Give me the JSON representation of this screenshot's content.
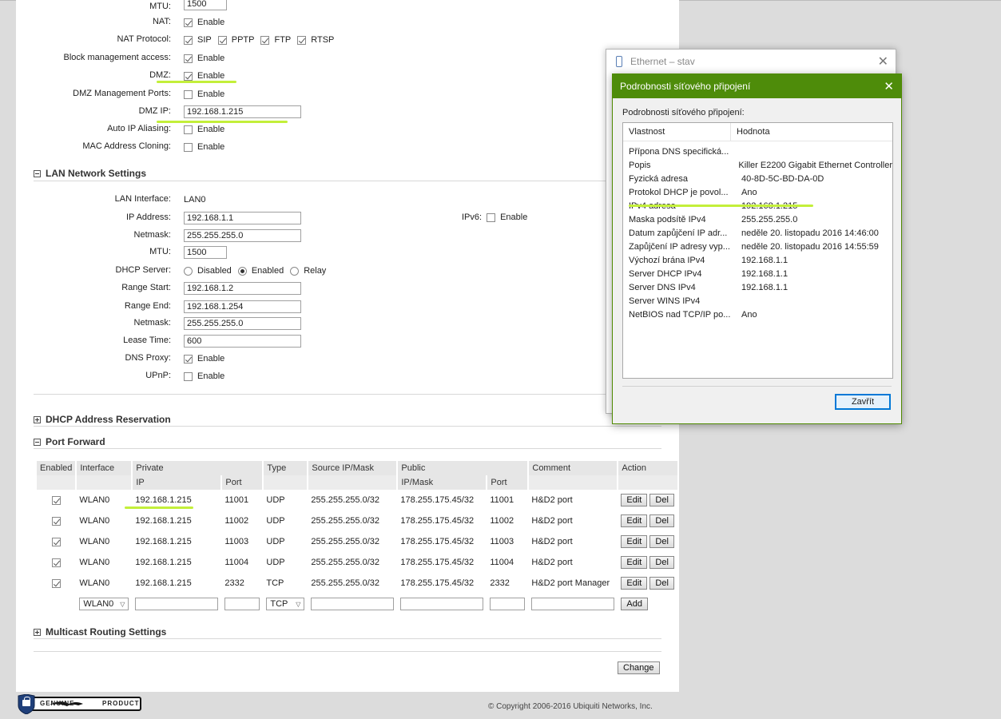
{
  "wan": {
    "mtu_label": "MTU:",
    "mtu_value": "1500",
    "nat_label": "NAT:",
    "nat_enable": "Enable",
    "nat_protocol_label": "NAT Protocol:",
    "nat_protocols": [
      "SIP",
      "PPTP",
      "FTP",
      "RTSP"
    ],
    "block_mgmt_label": "Block management access:",
    "block_mgmt_enable": "Enable",
    "dmz_label": "DMZ:",
    "dmz_enable": "Enable",
    "dmz_ports_label": "DMZ Management Ports:",
    "dmz_ports_enable": "Enable",
    "dmz_ip_label": "DMZ IP:",
    "dmz_ip_value": "192.168.1.215",
    "auto_ip_label": "Auto IP Aliasing:",
    "auto_ip_enable": "Enable",
    "mac_clone_label": "MAC Address Cloning:",
    "mac_clone_enable": "Enable"
  },
  "lan": {
    "section_title": "LAN Network Settings",
    "interface_label": "LAN Interface:",
    "interface_value": "LAN0",
    "ip_label": "IP Address:",
    "ip_value": "192.168.1.1",
    "netmask_label": "Netmask:",
    "netmask_value": "255.255.255.0",
    "mtu_label": "MTU:",
    "mtu_value": "1500",
    "ipv6_label": "IPv6:",
    "ipv6_enable": "Enable",
    "dhcp_label": "DHCP Server:",
    "dhcp_disabled": "Disabled",
    "dhcp_enabled": "Enabled",
    "dhcp_relay": "Relay",
    "range_start_label": "Range Start:",
    "range_start_value": "192.168.1.2",
    "range_end_label": "Range End:",
    "range_end_value": "192.168.1.254",
    "netmask2_label": "Netmask:",
    "netmask2_value": "255.255.255.0",
    "lease_label": "Lease Time:",
    "lease_value": "600",
    "dns_proxy_label": "DNS Proxy:",
    "dns_proxy_enable": "Enable",
    "upnp_label": "UPnP:",
    "upnp_enable": "Enable"
  },
  "dhcp_reservation": {
    "section_title": "DHCP Address Reservation"
  },
  "port_forward": {
    "section_title": "Port Forward",
    "headers": {
      "enabled": "Enabled",
      "interface": "Interface",
      "private": "Private",
      "type": "Type",
      "source": "Source IP/Mask",
      "public": "Public",
      "comment": "Comment",
      "action": "Action",
      "ip": "IP",
      "port": "Port",
      "ipmask": "IP/Mask",
      "port2": "Port"
    },
    "rows": [
      {
        "interface": "WLAN0",
        "ip": "192.168.1.215",
        "port": "11001",
        "type": "UDP",
        "source": "255.255.255.0/32",
        "public": "178.255.175.45/32",
        "pport": "11001",
        "comment": "H&D2 port"
      },
      {
        "interface": "WLAN0",
        "ip": "192.168.1.215",
        "port": "11002",
        "type": "UDP",
        "source": "255.255.255.0/32",
        "public": "178.255.175.45/32",
        "pport": "11002",
        "comment": "H&D2 port"
      },
      {
        "interface": "WLAN0",
        "ip": "192.168.1.215",
        "port": "11003",
        "type": "UDP",
        "source": "255.255.255.0/32",
        "public": "178.255.175.45/32",
        "pport": "11003",
        "comment": "H&D2 port"
      },
      {
        "interface": "WLAN0",
        "ip": "192.168.1.215",
        "port": "11004",
        "type": "UDP",
        "source": "255.255.255.0/32",
        "public": "178.255.175.45/32",
        "pport": "11004",
        "comment": "H&D2 port"
      },
      {
        "interface": "WLAN0",
        "ip": "192.168.1.215",
        "port": "2332",
        "type": "TCP",
        "source": "255.255.255.0/32",
        "public": "178.255.175.45/32",
        "pport": "2332",
        "comment": "H&D2 port Manager"
      }
    ],
    "edit_label": "Edit",
    "del_label": "Del",
    "new_interface": "WLAN0",
    "new_type": "TCP",
    "add_label": "Add"
  },
  "multicast": {
    "section_title": "Multicast Routing Settings"
  },
  "change_label": "Change",
  "footer": {
    "copyright": "© Copyright 2006-2016 Ubiquiti Networks, Inc.",
    "badge_left": "GENUINE",
    "badge_right": "PRODUCT"
  },
  "ethernet_window": {
    "title": "Ethernet – stav"
  },
  "details_window": {
    "title": "Podrobnosti síťového připojení",
    "caption": "Podrobnosti síťového připojení:",
    "col_property": "Vlastnost",
    "col_value": "Hodnota",
    "rows": [
      {
        "k": "Přípona DNS specifická...",
        "v": ""
      },
      {
        "k": "Popis",
        "v": "Killer E2200 Gigabit Ethernet Controller"
      },
      {
        "k": "Fyzická adresa",
        "v": "40-8D-5C-BD-DA-0D"
      },
      {
        "k": "Protokol DHCP je povol...",
        "v": "Ano"
      },
      {
        "k": "IPv4 adresa",
        "v": "192.168.1.215"
      },
      {
        "k": "Maska podsítě IPv4",
        "v": "255.255.255.0"
      },
      {
        "k": "Datum zapůjčení IP adr...",
        "v": "neděle 20. listopadu 2016 14:46:00"
      },
      {
        "k": "Zapůjčení IP adresy vyp...",
        "v": "neděle 20. listopadu 2016 14:55:59"
      },
      {
        "k": "Výchozí brána IPv4",
        "v": "192.168.1.1"
      },
      {
        "k": "Server DHCP IPv4",
        "v": "192.168.1.1"
      },
      {
        "k": "Server DNS IPv4",
        "v": "192.168.1.1"
      },
      {
        "k": "Server WINS IPv4",
        "v": ""
      },
      {
        "k": "NetBIOS nad TCP/IP po...",
        "v": "Ano"
      }
    ],
    "close_label": "Zavřít"
  },
  "colors": {
    "highlight": "#c3ef3a",
    "dialog_title": "#4e8c0a"
  },
  "icons": [
    "ethernet-icon",
    "close-icon",
    "collapse-icon",
    "expand-icon",
    "lock-icon",
    "bird-logo-icon"
  ]
}
